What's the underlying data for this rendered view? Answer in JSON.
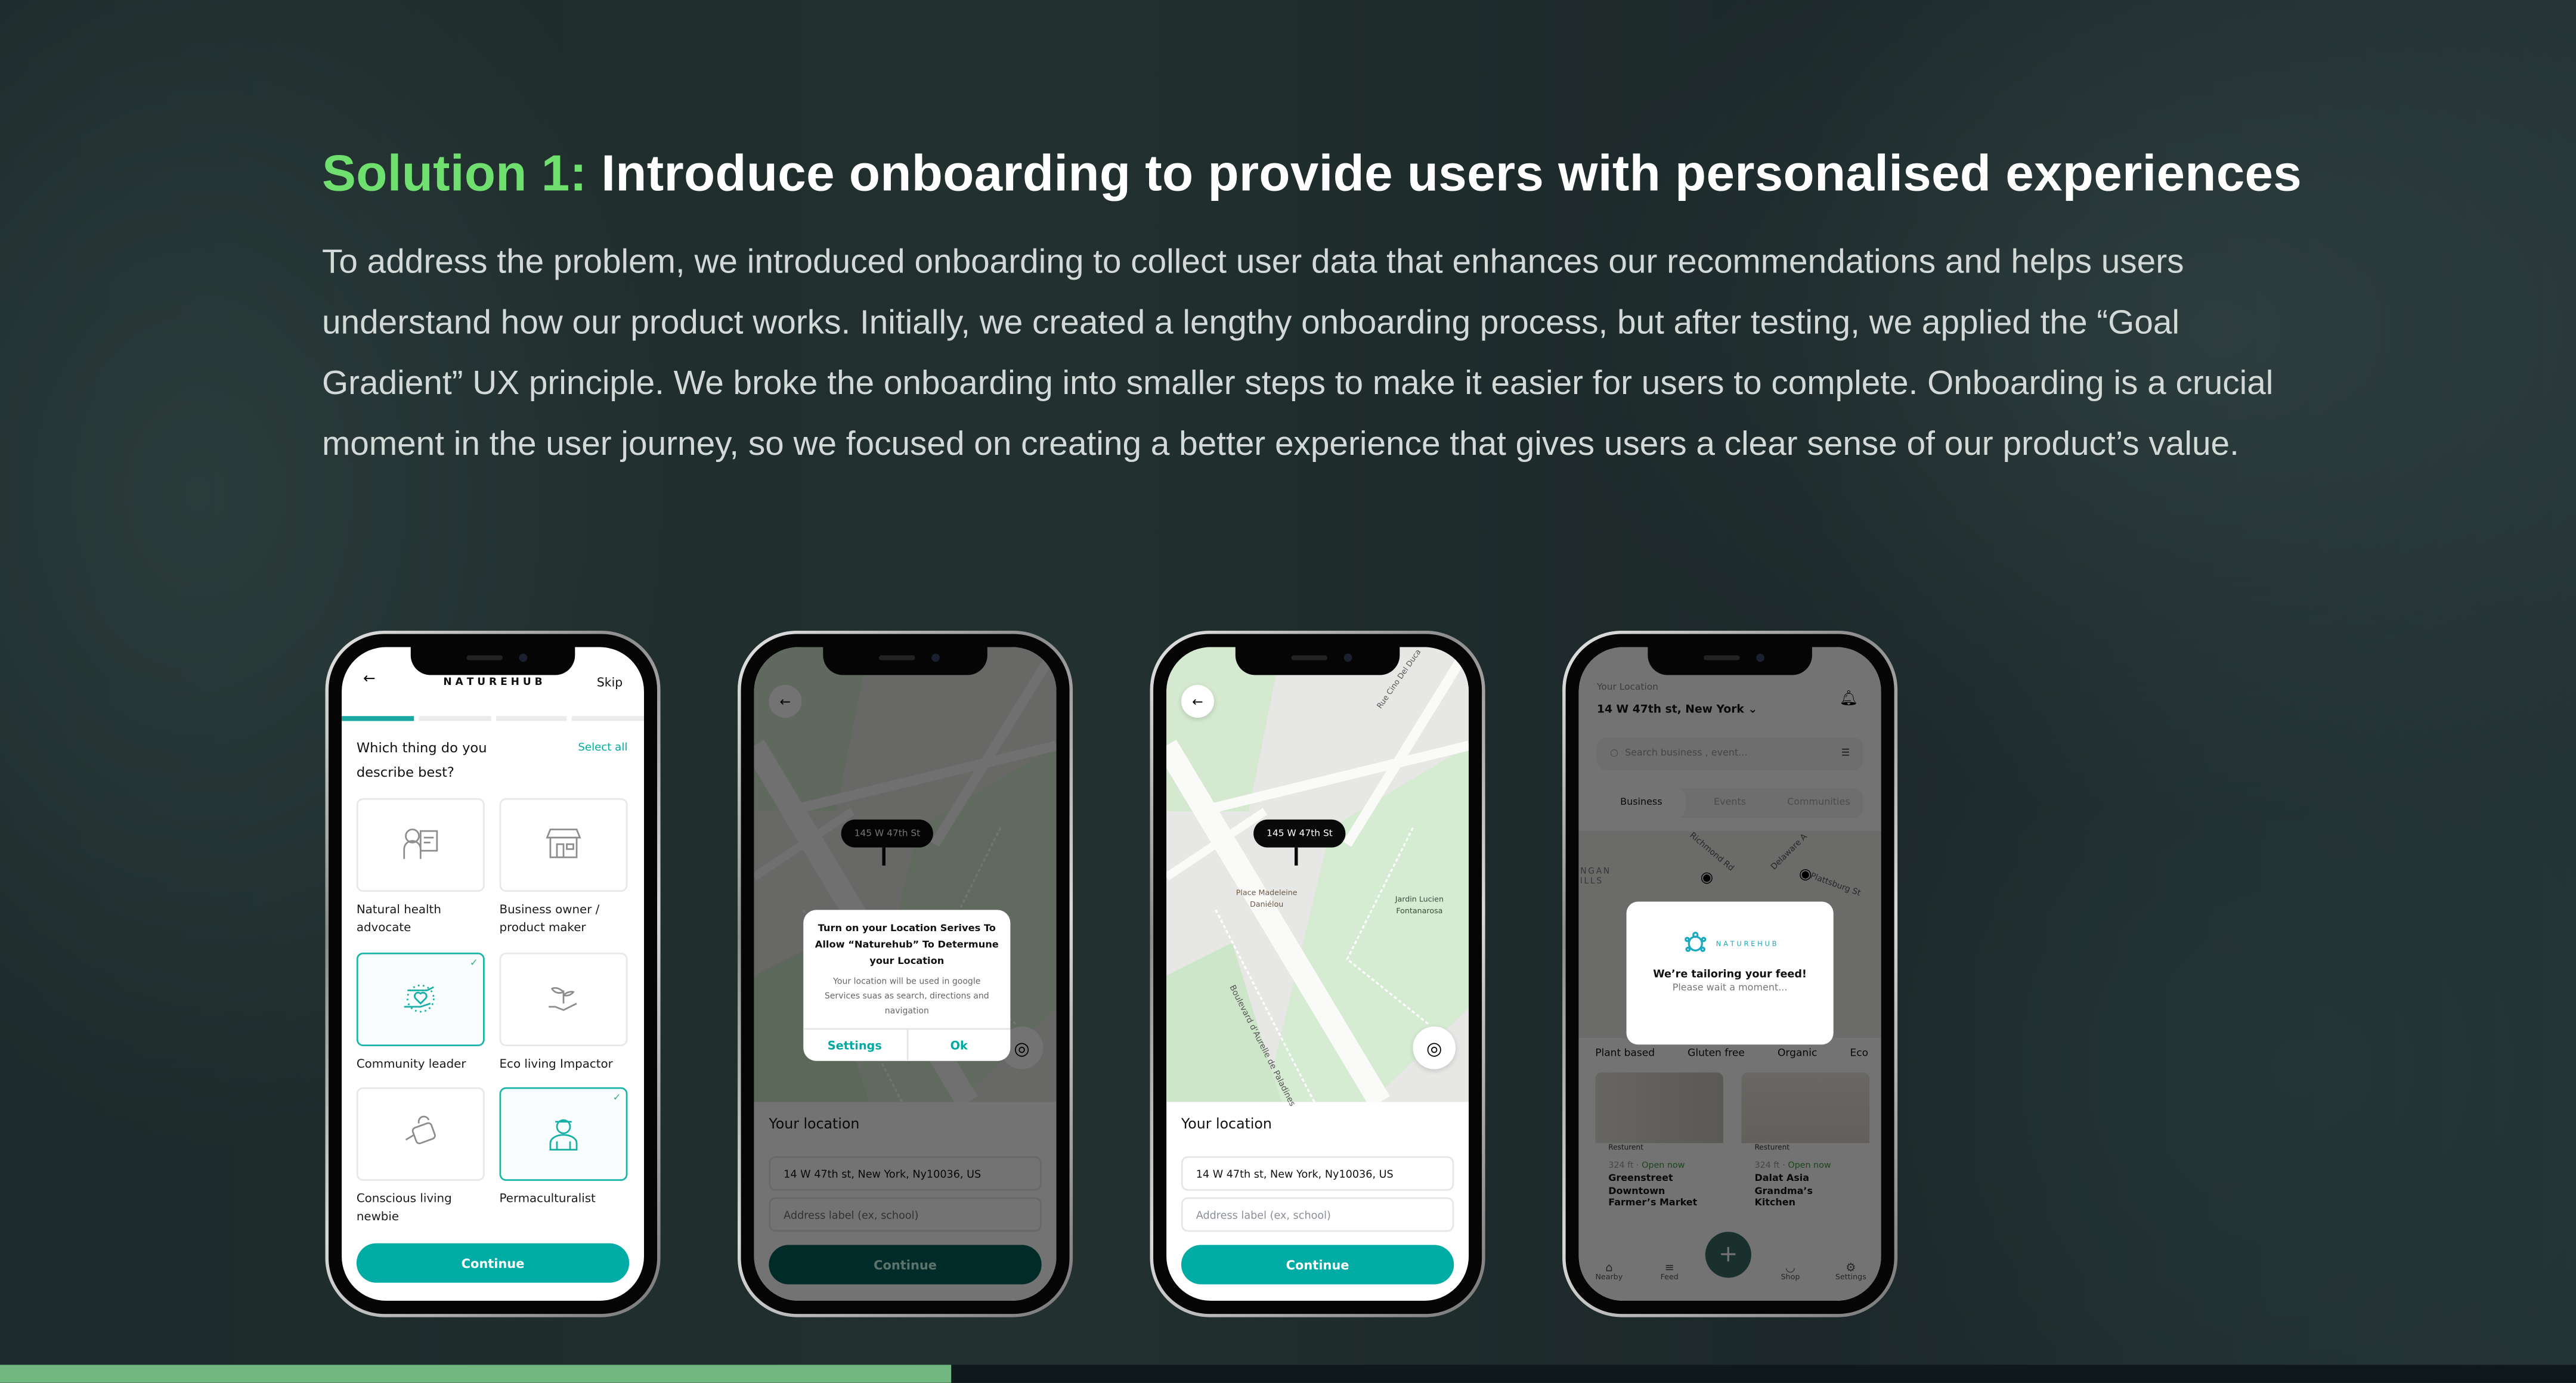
{
  "heading": {
    "highlight": "Solution 1:",
    "title": "Introduce onboarding to provide users with personalised experiences"
  },
  "body": "To address the problem, we introduced onboarding to collect user data that enhances our recommendations and helps users understand how our product works. Initially, we created a lengthy onboarding process, but after testing, we applied the “Goal Gradient” UX principle. We broke the onboarding into smaller steps to make it easier for users to complete. Onboarding is a crucial moment in the user journey, so we focused on creating a better experience that gives users a clear sense of our product’s value.",
  "colors": {
    "accent_green": "#6fe06f",
    "app_teal": "#01aca4",
    "progress_green": "#72b77f"
  },
  "phone1": {
    "brand": "N A T U R E H U B",
    "skip": "Skip",
    "back_icon": "arrow-left-icon",
    "step": 1,
    "steps_total": 4,
    "question": "Which thing do you describe best?",
    "select_all": "Select all",
    "cards": [
      {
        "label": "Natural health advocate",
        "icon": "health-advocate-icon",
        "selected": false
      },
      {
        "label": "Business owner / product maker",
        "icon": "storefront-icon",
        "selected": false
      },
      {
        "label": "Community leader",
        "icon": "hands-heart-icon",
        "selected": true
      },
      {
        "label": "Eco living Impactor",
        "icon": "plant-hand-icon",
        "selected": false
      },
      {
        "label": "Conscious living newbie",
        "icon": "watering-can-icon",
        "selected": false
      },
      {
        "label": "Permaculturalist",
        "icon": "farmer-icon",
        "selected": true
      }
    ],
    "continue": "Continue"
  },
  "phone2": {
    "pin": "145 W 47th St",
    "dialog": {
      "title": "Turn on your Location Serives To Allow “Naturehub” To Determune your Location",
      "message": "Your location will be used in google Services suas as search, directions and navigation",
      "settings": "Settings",
      "ok": "Ok"
    },
    "your_location": "Your location",
    "address": "14 W 47th st, New York, Ny10036, US",
    "label_placeholder": "Address label (ex, school)",
    "continue": "Continue"
  },
  "phone3": {
    "pin": "145 W 47th St",
    "map_labels": [
      "Place Madeleine Daniélou",
      "Jardin Lucien Fontanarosa",
      "Boulevard d'Aurelle de Paladines",
      "Rue Cino Del Duca"
    ],
    "your_location": "Your location",
    "address": "14 W 47th st, New York, Ny10036, US",
    "label_placeholder": "Address label (ex, school)",
    "continue": "Continue"
  },
  "phone4": {
    "location_label": "Your Location",
    "location": "14 W 47th st, New York",
    "search_placeholder": "Search business , event...",
    "tabs": [
      "Business",
      "Events",
      "Communities"
    ],
    "map_labels": [
      "Richmond Rd",
      "Delaware A",
      "Plattsburg St",
      "ONGAN HILLS"
    ],
    "chips": [
      "Plant based",
      "Gluten free",
      "Organic",
      "Eco"
    ],
    "cards": [
      {
        "tag": "Resturent",
        "distance": "324 ft",
        "status": "Open now",
        "name": "Greenstreet Downtown Farmer’s Market"
      },
      {
        "tag": "Resturent",
        "distance": "324 ft",
        "status": "Open now",
        "name": "Dalat Asia Grandma’s Kitchen"
      }
    ],
    "nav": [
      "Nearby",
      "Feed",
      "Shop",
      "Settings"
    ],
    "modal": {
      "brand": "N A T U R E H U B",
      "title": "We’re tailoring your feed!",
      "subtitle": "Please wait a moment..."
    }
  },
  "slide_progress_percent": 36.9
}
